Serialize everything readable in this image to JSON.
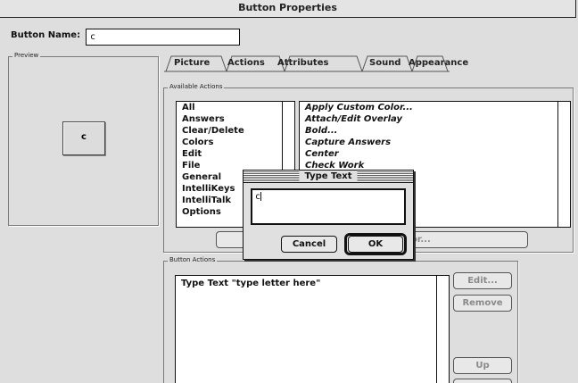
{
  "window": {
    "title": "Button Properties"
  },
  "button_name": {
    "label": "Button Name:",
    "value": "c"
  },
  "preview": {
    "label": "Preview",
    "button_text": "c"
  },
  "tabs": [
    {
      "label": "Picture",
      "selected": false
    },
    {
      "label": "Actions",
      "selected": true
    },
    {
      "label": "Attributes",
      "selected": false
    },
    {
      "label": "Sound",
      "selected": false
    },
    {
      "label": "Appearance",
      "selected": false
    }
  ],
  "available_actions": {
    "label": "Available Actions",
    "categories": [
      "All",
      "Answers",
      "Clear/Delete",
      "Colors",
      "Edit",
      "File",
      "General",
      "IntelliKeys",
      "IntelliTalk",
      "Options"
    ],
    "actions": [
      "Apply Custom Color...",
      "Attach/Edit Overlay",
      "Bold...",
      "Capture Answers",
      "Center",
      "Check Work"
    ],
    "add_button_partial": "or..."
  },
  "button_actions": {
    "label": "Button Actions",
    "items": [
      "Type Text \"type letter here\""
    ],
    "edit_label": "Edit...",
    "remove_label": "Remove",
    "up_label": "Up"
  },
  "type_text_dialog": {
    "title": "Type Text",
    "value": "c",
    "cancel_label": "Cancel",
    "ok_label": "OK"
  }
}
